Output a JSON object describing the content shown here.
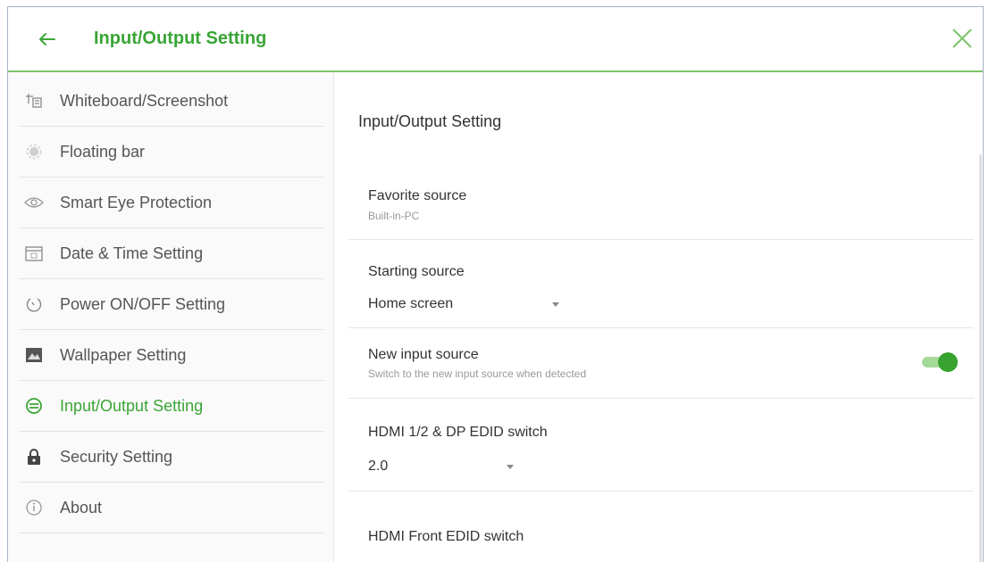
{
  "header": {
    "title": "Input/Output Setting",
    "back_icon": "back-arrow-icon",
    "close_icon": "close-icon",
    "accent_color": "#3aa536"
  },
  "sidebar": {
    "items": [
      {
        "label": "Whiteboard/Screenshot",
        "icon": "whiteboard-icon",
        "active": false
      },
      {
        "label": "Floating bar",
        "icon": "floating-bar-icon",
        "active": false
      },
      {
        "label": "Smart Eye Protection",
        "icon": "eye-icon",
        "active": false
      },
      {
        "label": "Date & Time Setting",
        "icon": "calendar-icon",
        "active": false
      },
      {
        "label": "Power ON/OFF Setting",
        "icon": "power-icon",
        "active": false
      },
      {
        "label": "Wallpaper Setting",
        "icon": "wallpaper-icon",
        "active": false
      },
      {
        "label": "Input/Output Setting",
        "icon": "input-output-icon",
        "active": true
      },
      {
        "label": "Security Setting",
        "icon": "lock-icon",
        "active": false
      },
      {
        "label": "About",
        "icon": "info-icon",
        "active": false
      }
    ]
  },
  "main": {
    "title": "Input/Output Setting",
    "favorite_source": {
      "label": "Favorite source",
      "value": "Built-in-PC"
    },
    "starting_source": {
      "label": "Starting source",
      "value": "Home screen"
    },
    "new_input_source": {
      "label": "New input source",
      "description": "Switch to the new input source when detected",
      "enabled": true
    },
    "hdmi_dp_edid": {
      "label": "HDMI 1/2 & DP EDID switch",
      "value": "2.0"
    },
    "hdmi_front_edid": {
      "label": "HDMI Front EDID switch"
    }
  }
}
